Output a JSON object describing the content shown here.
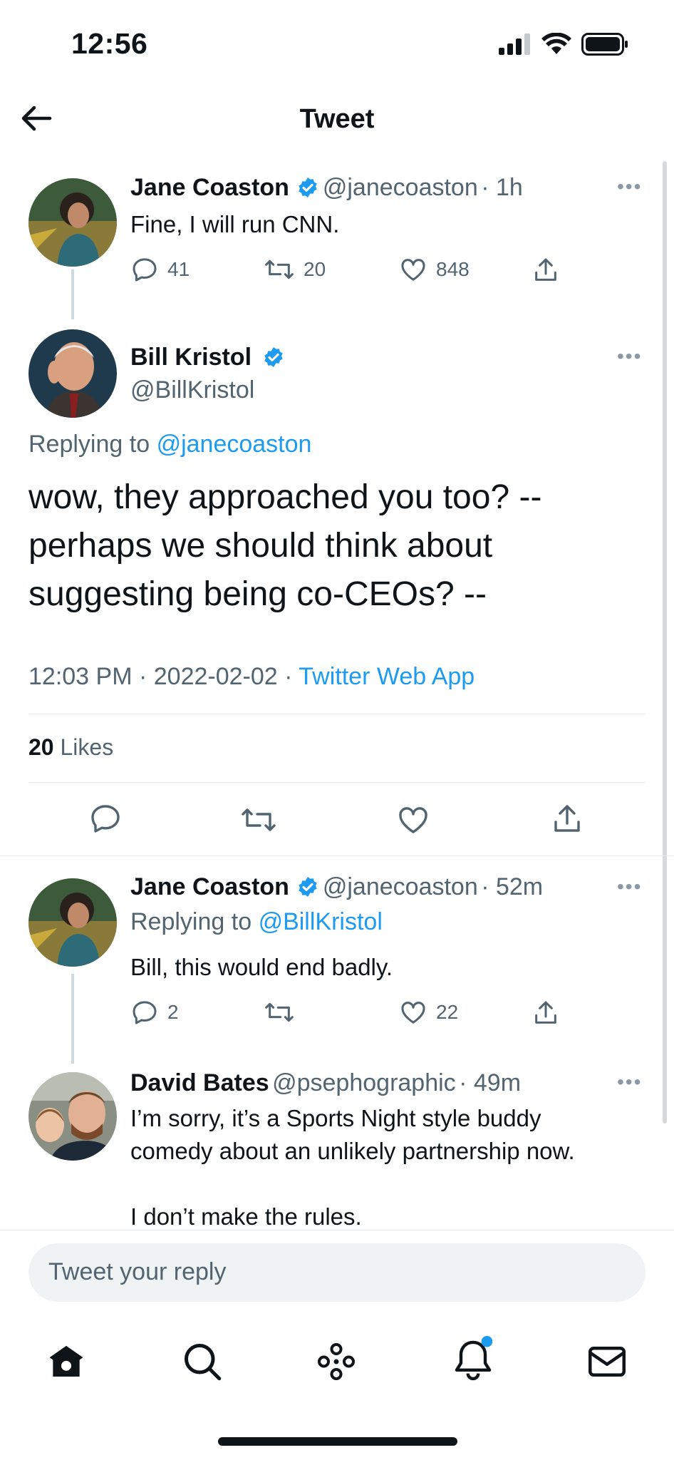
{
  "status_bar": {
    "time": "12:56"
  },
  "header": {
    "title": "Tweet"
  },
  "tweet1": {
    "name": "Jane Coaston",
    "handle": "@janecoaston",
    "time": "· 1h",
    "text": "Fine, I will run CNN.",
    "replies": "41",
    "retweets": "20",
    "likes": "848"
  },
  "main_tweet": {
    "name": "Bill Kristol",
    "handle": "@BillKristol",
    "replying_prefix": "Replying to",
    "replying_to": "@janecoaston",
    "text_lines": [
      "wow, they approached you too? --",
      "perhaps we should think about",
      "suggesting being co-CEOs? --"
    ],
    "timestamp": "12:03 PM · 2022-02-02 ·",
    "source": "Twitter Web App",
    "likes_count": "20",
    "likes_label": "Likes"
  },
  "reply1": {
    "name": "Jane Coaston",
    "handle": "@janecoaston",
    "time": "· 52m",
    "replying_prefix": "Replying to",
    "replying_to": "@BillKristol",
    "text": "Bill, this would end badly.",
    "replies": "2",
    "likes": "22"
  },
  "reply2": {
    "name": "David Bates",
    "handle": "@psephographic",
    "time": "· 49m",
    "text_lines": [
      "I’m sorry, it’s a Sports Night style buddy",
      "comedy about an unlikely partnership now.",
      "",
      "I don’t make the rules."
    ]
  },
  "composer": {
    "placeholder": "Tweet your reply"
  },
  "colors": {
    "accent": "#1d9bf0",
    "text": "#0f1419",
    "secondary": "#536471",
    "notification_dot": "#1d9bf0"
  },
  "icons": [
    "back-arrow-icon",
    "verified-badge-icon",
    "reply-icon",
    "retweet-icon",
    "like-icon",
    "share-icon",
    "more-icon",
    "home-icon",
    "search-icon",
    "spaces-icon",
    "notifications-icon",
    "messages-icon",
    "signal-icon",
    "wifi-icon",
    "battery-icon"
  ]
}
